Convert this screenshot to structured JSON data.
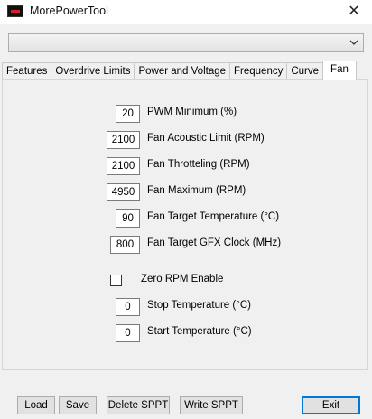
{
  "window": {
    "title": "MorePowerTool",
    "close_glyph": "✕"
  },
  "dropdown": {
    "selected": "",
    "icon": "chevron-down-icon"
  },
  "tabs": [
    {
      "label": "Features",
      "active": false
    },
    {
      "label": "Overdrive Limits",
      "active": false
    },
    {
      "label": "Power and Voltage",
      "active": false
    },
    {
      "label": "Frequency",
      "active": false
    },
    {
      "label": "Curve",
      "active": false
    },
    {
      "label": "Fan",
      "active": true
    }
  ],
  "fields": {
    "pwm_minimum": {
      "value": "20",
      "label": "PWM Minimum (%)"
    },
    "fan_acoustic_limit": {
      "value": "2100",
      "label": "Fan Acoustic Limit (RPM)"
    },
    "fan_throttling": {
      "value": "2100",
      "label": "Fan Throtteling (RPM)"
    },
    "fan_maximum": {
      "value": "4950",
      "label": "Fan Maximum (RPM)"
    },
    "fan_target_temperature": {
      "value": "90",
      "label": "Fan Target Temperature (°C)"
    },
    "fan_target_gfx_clock": {
      "value": "800",
      "label": "Fan Target GFX Clock (MHz)"
    },
    "stop_temperature": {
      "value": "0",
      "label": "Stop Temperature (°C)"
    },
    "start_temperature": {
      "value": "0",
      "label": "Start Temperature (°C)"
    }
  },
  "zero_rpm": {
    "label": "Zero RPM Enable",
    "checked": false
  },
  "buttons": {
    "load": "Load",
    "save": "Save",
    "delete_sppt": "Delete SPPT",
    "write_sppt": "Write SPPT",
    "exit": "Exit"
  },
  "colors": {
    "focus_border": "#0078d7",
    "icon_red": "#d81f26"
  }
}
